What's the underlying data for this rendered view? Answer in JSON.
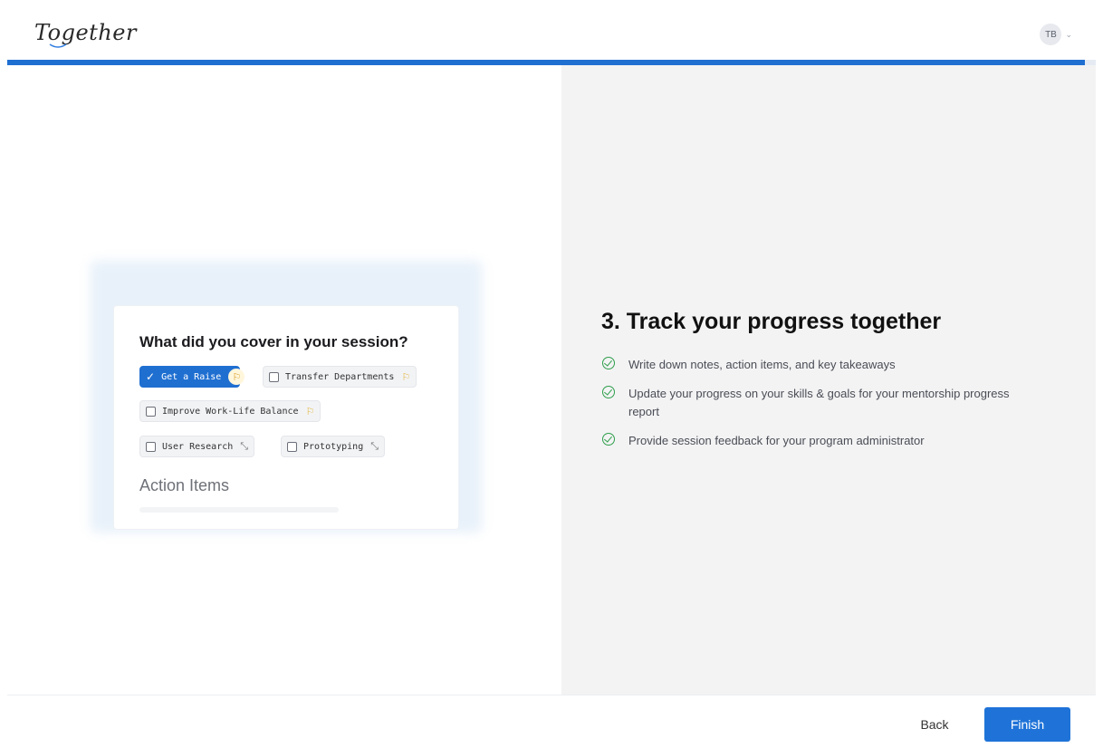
{
  "header": {
    "logo_text": "Together",
    "avatar_initials": "TB",
    "avatar_chevron": "⌄"
  },
  "progress": {
    "fraction": 0.99,
    "color": "#1f6fd1"
  },
  "preview_card": {
    "title": "What did you cover in your session?",
    "chips": [
      {
        "label": "Get a Raise",
        "selected": true,
        "trailing": "flag-icon"
      },
      {
        "label": "Transfer Departments",
        "selected": false,
        "trailing": "flag-icon"
      },
      {
        "label": "Improve Work-Life Balance",
        "selected": false,
        "trailing": "flag-icon"
      },
      {
        "label": "User Research",
        "selected": false,
        "trailing": "expand-icon"
      },
      {
        "label": "Prototyping",
        "selected": false,
        "trailing": "expand-icon"
      }
    ],
    "section_heading": "Action Items"
  },
  "step": {
    "title": "3. Track your progress together",
    "bullets": [
      "Write down notes, action items, and key takeaways",
      "Update your progress on your skills & goals for your mentorship progress report",
      "Provide session feedback for your program administrator"
    ]
  },
  "footer": {
    "back_label": "Back",
    "finish_label": "Finish"
  },
  "colors": {
    "accent": "#1f73d8",
    "success": "#2e9e4a",
    "flag": "#e2b53a"
  }
}
